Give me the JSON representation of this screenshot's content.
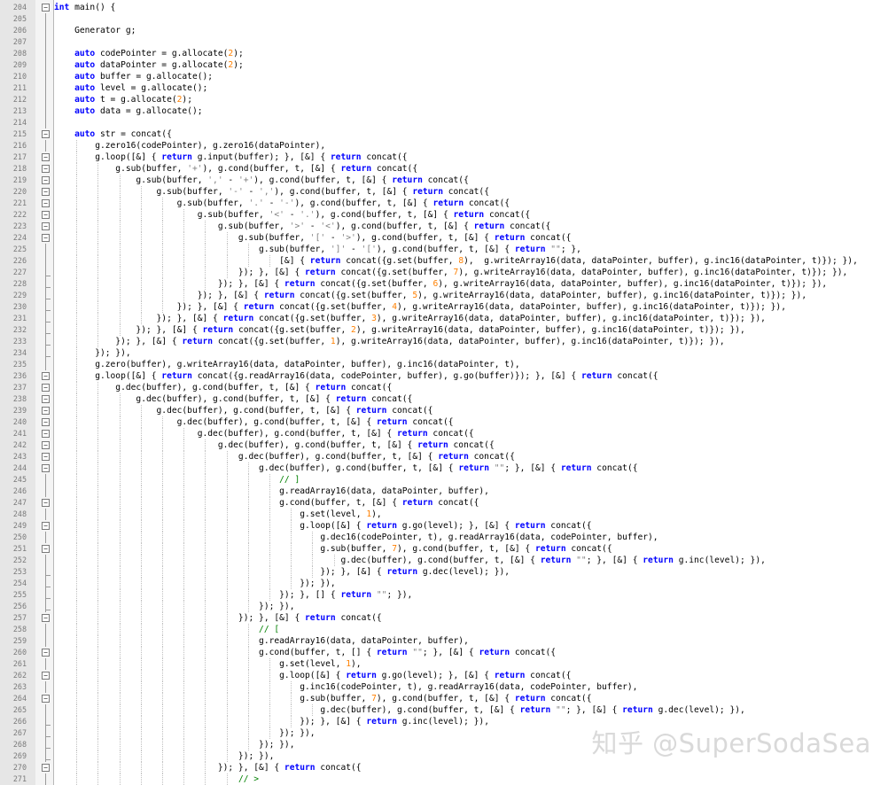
{
  "editor": {
    "language": "C++",
    "first_visible_line": 204,
    "lines": [
      "int main() {",
      "",
      "    Generator g;",
      "",
      "    auto codePointer = g.allocate(2);",
      "    auto dataPointer = g.allocate(2);",
      "    auto buffer = g.allocate();",
      "    auto level = g.allocate();",
      "    auto t = g.allocate(2);",
      "    auto data = g.allocate();",
      "",
      "    auto str = concat({",
      "        g.zero16(codePointer), g.zero16(dataPointer),",
      "        g.loop([&] { return g.input(buffer); }, [&] { return concat({",
      "            g.sub(buffer, '+'), g.cond(buffer, t, [&] { return concat({",
      "                g.sub(buffer, ',' - '+'), g.cond(buffer, t, [&] { return concat({",
      "                    g.sub(buffer, '-' - ','), g.cond(buffer, t, [&] { return concat({",
      "                        g.sub(buffer, '.' - '-'), g.cond(buffer, t, [&] { return concat({",
      "                            g.sub(buffer, '<' - '.'), g.cond(buffer, t, [&] { return concat({",
      "                                g.sub(buffer, '>' - '<'), g.cond(buffer, t, [&] { return concat({",
      "                                    g.sub(buffer, '[' - '>'), g.cond(buffer, t, [&] { return concat({",
      "                                        g.sub(buffer, ']' - '['), g.cond(buffer, t, [&] { return \"\"; },",
      "                                            [&] { return concat({g.set(buffer, 8),  g.writeArray16(data, dataPointer, buffer), g.inc16(dataPointer, t)}); }),",
      "                                    }); }, [&] { return concat({g.set(buffer, 7), g.writeArray16(data, dataPointer, buffer), g.inc16(dataPointer, t)}); }),",
      "                                }); }, [&] { return concat({g.set(buffer, 6), g.writeArray16(data, dataPointer, buffer), g.inc16(dataPointer, t)}); }),",
      "                            }); }, [&] { return concat({g.set(buffer, 5), g.writeArray16(data, dataPointer, buffer), g.inc16(dataPointer, t)}); }),",
      "                        }); }, [&] { return concat({g.set(buffer, 4), g.writeArray16(data, dataPointer, buffer), g.inc16(dataPointer, t)}); }),",
      "                    }); }, [&] { return concat({g.set(buffer, 3), g.writeArray16(data, dataPointer, buffer), g.inc16(dataPointer, t)}); }),",
      "                }); }, [&] { return concat({g.set(buffer, 2), g.writeArray16(data, dataPointer, buffer), g.inc16(dataPointer, t)}); }),",
      "            }); }, [&] { return concat({g.set(buffer, 1), g.writeArray16(data, dataPointer, buffer), g.inc16(dataPointer, t)}); }),",
      "        }); }),",
      "        g.zero(buffer), g.writeArray16(data, dataPointer, buffer), g.inc16(dataPointer, t),",
      "        g.loop([&] { return concat({g.readArray16(data, codePointer, buffer), g.go(buffer)}); }, [&] { return concat({",
      "            g.dec(buffer), g.cond(buffer, t, [&] { return concat({",
      "                g.dec(buffer), g.cond(buffer, t, [&] { return concat({",
      "                    g.dec(buffer), g.cond(buffer, t, [&] { return concat({",
      "                        g.dec(buffer), g.cond(buffer, t, [&] { return concat({",
      "                            g.dec(buffer), g.cond(buffer, t, [&] { return concat({",
      "                                g.dec(buffer), g.cond(buffer, t, [&] { return concat({",
      "                                    g.dec(buffer), g.cond(buffer, t, [&] { return concat({",
      "                                        g.dec(buffer), g.cond(buffer, t, [&] { return \"\"; }, [&] { return concat({",
      "                                            // ]",
      "                                            g.readArray16(data, dataPointer, buffer),",
      "                                            g.cond(buffer, t, [&] { return concat({",
      "                                                g.set(level, 1),",
      "                                                g.loop([&] { return g.go(level); }, [&] { return concat({",
      "                                                    g.dec16(codePointer, t), g.readArray16(data, codePointer, buffer),",
      "                                                    g.sub(buffer, 7), g.cond(buffer, t, [&] { return concat({",
      "                                                        g.dec(buffer), g.cond(buffer, t, [&] { return \"\"; }, [&] { return g.inc(level); }),",
      "                                                    }); }, [&] { return g.dec(level); }),",
      "                                                }); }),",
      "                                            }); }, [] { return \"\"; }),",
      "                                        }); }),",
      "                                    }); }, [&] { return concat({",
      "                                        // [",
      "                                        g.readArray16(data, dataPointer, buffer),",
      "                                        g.cond(buffer, t, [] { return \"\"; }, [&] { return concat({",
      "                                            g.set(level, 1),",
      "                                            g.loop([&] { return g.go(level); }, [&] { return concat({",
      "                                                g.inc16(codePointer, t), g.readArray16(data, codePointer, buffer),",
      "                                                g.sub(buffer, 7), g.cond(buffer, t, [&] { return concat({",
      "                                                    g.dec(buffer), g.cond(buffer, t, [&] { return \"\"; }, [&] { return g.dec(level); }),",
      "                                                }); }, [&] { return g.inc(level); }),",
      "                                            }); }),",
      "                                        }); }),",
      "                                    }); }),",
      "                                }); }, [&] { return concat({",
      "                                    // >"
    ]
  },
  "watermark": "知乎 @SuperSodaSea",
  "colors": {
    "keyword": "#0000ff",
    "number": "#ff8000",
    "string": "#808080",
    "comment": "#008000",
    "gutter_bg": "#e6e6e6"
  }
}
